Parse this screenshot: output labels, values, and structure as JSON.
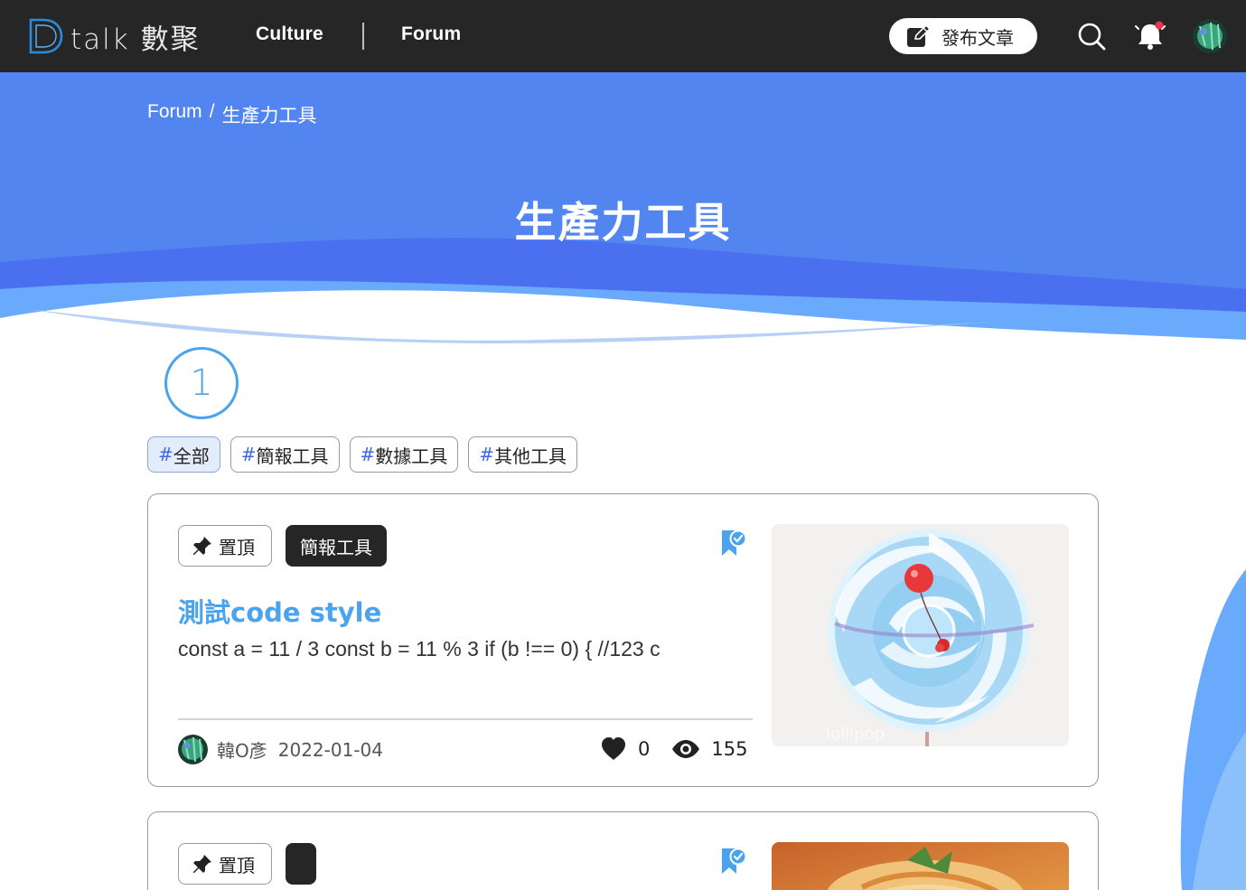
{
  "header": {
    "logo_text": "talk 數聚",
    "nav": [
      {
        "label": "Culture"
      },
      {
        "label": "Forum"
      }
    ],
    "publish_label": "發布文章",
    "icons": {
      "search": "search-icon",
      "notification": "bell-icon",
      "avatar": "user-avatar"
    }
  },
  "hero": {
    "breadcrumb": {
      "root": "Forum",
      "separator": "/",
      "current": "生產力工具"
    },
    "title": "生產力工具",
    "colors": {
      "primary": "#5285f0",
      "wave_light": "#6aaafc",
      "wave_dark": "#4a6fef"
    }
  },
  "pagination": {
    "current_page": "1"
  },
  "tags": [
    {
      "hash": "#",
      "label": "全部",
      "active": true
    },
    {
      "hash": "#",
      "label": "簡報工具",
      "active": false
    },
    {
      "hash": "#",
      "label": "數據工具",
      "active": false
    },
    {
      "hash": "#",
      "label": "其他工具",
      "active": false
    }
  ],
  "posts": [
    {
      "pin_label": "置頂",
      "category": "簡報工具",
      "title": "測試code style",
      "excerpt": "const a = 11 / 3 const b = 11 % 3 if (b !== 0) { //123 c",
      "author": "韓O彥",
      "date": "2022-01-04",
      "likes": "0",
      "views": "155",
      "image_caption": "lollipop"
    },
    {
      "pin_label": "置頂",
      "category": ""
    }
  ],
  "accent_color": "#4aa3ee"
}
